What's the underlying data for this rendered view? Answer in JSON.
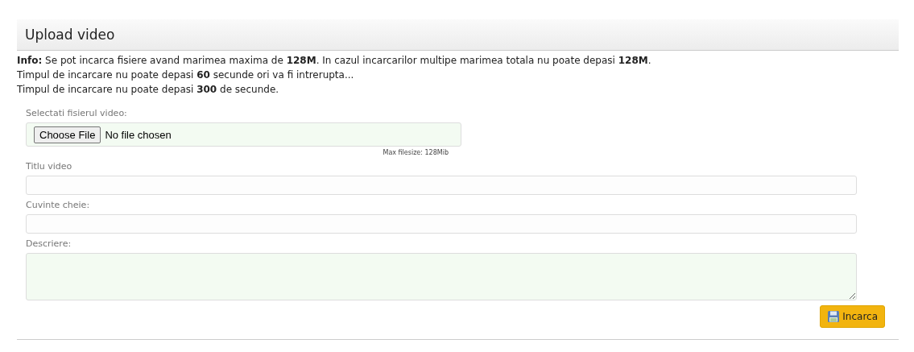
{
  "panel": {
    "title": "Upload video"
  },
  "info_lines": [
    "**Info:** Se pot incarca fisiere avand marimea maxima de **128M**. In cazul incarcarilor multipe marimea totala nu poate depasi **128M**.",
    "Timpul de incarcare nu poate depasi **60** secunde ori va fi intrerupta...",
    "Timpul de incarcare nu poate depasi **300** de secunde."
  ],
  "fields": [
    {
      "kind": "file",
      "label": "Selectati fisierul video:",
      "button": "Choose File",
      "status": "No file chosen",
      "hint": "Max filesize: 128Mib"
    },
    {
      "kind": "text",
      "label": "Titlu video"
    },
    {
      "kind": "text",
      "label": "Cuvinte cheie:"
    },
    {
      "kind": "textarea",
      "label": "Descriere:"
    }
  ],
  "submit": {
    "label": "Incarca"
  }
}
